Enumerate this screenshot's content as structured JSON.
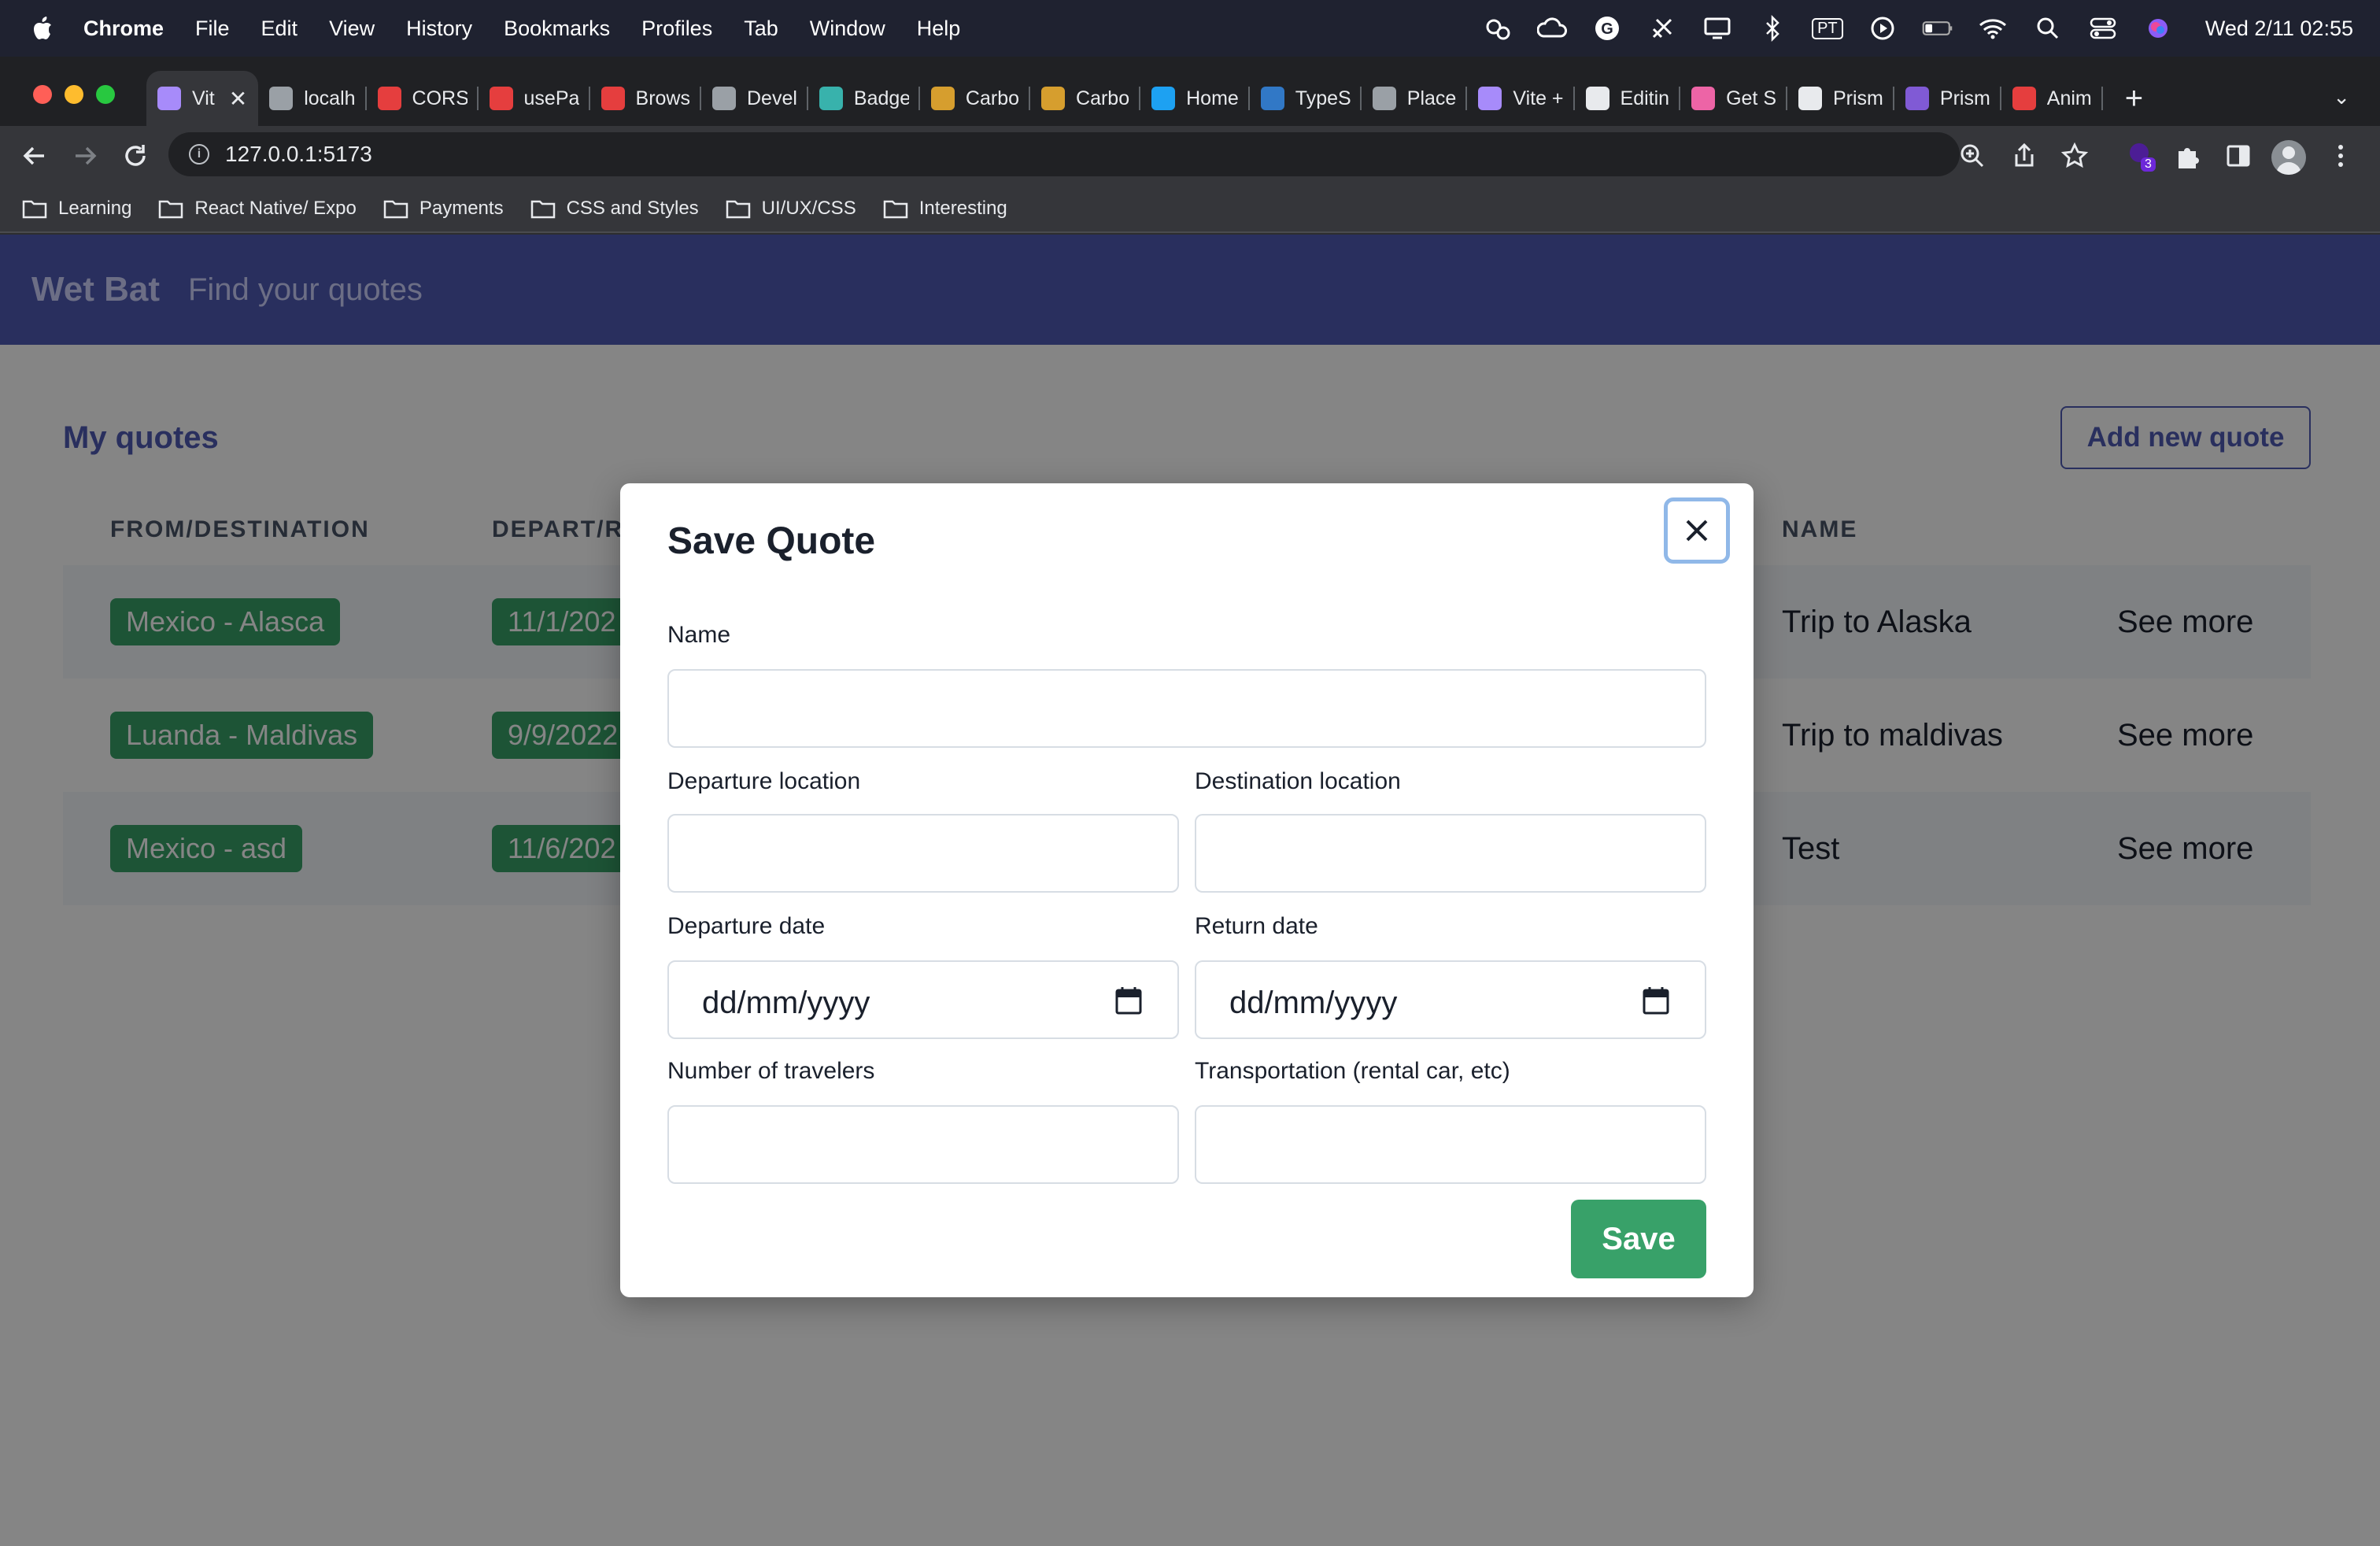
{
  "menubar": {
    "app": "Chrome",
    "items": [
      "File",
      "Edit",
      "View",
      "History",
      "Bookmarks",
      "Profiles",
      "Tab",
      "Window",
      "Help"
    ],
    "input_source": "PT",
    "clock": "Wed 2/11  02:55"
  },
  "browser": {
    "tabs": [
      {
        "label": "Vit",
        "active": true,
        "favicon_color": "#a78bfa"
      },
      {
        "label": "localh",
        "favicon_color": "#9aa0a6"
      },
      {
        "label": "CORS",
        "favicon_color": "#e53e3e"
      },
      {
        "label": "usePa",
        "favicon_color": "#e53e3e"
      },
      {
        "label": "Brows",
        "favicon_color": "#e53e3e"
      },
      {
        "label": "Devel",
        "favicon_color": "#9aa0a6"
      },
      {
        "label": "Badge",
        "favicon_color": "#38b2ac"
      },
      {
        "label": "Carbo",
        "favicon_color": "#d69e2e"
      },
      {
        "label": "Carbo",
        "favicon_color": "#d69e2e"
      },
      {
        "label": "Home",
        "favicon_color": "#1da1f2"
      },
      {
        "label": "TypeS",
        "favicon_color": "#3178c6"
      },
      {
        "label": "Place",
        "favicon_color": "#9aa0a6"
      },
      {
        "label": "Vite +",
        "favicon_color": "#a78bfa"
      },
      {
        "label": "Editin",
        "favicon_color": "#e8eaed"
      },
      {
        "label": "Get S",
        "favicon_color": "#ed64a6"
      },
      {
        "label": "Prism",
        "favicon_color": "#e8eaed"
      },
      {
        "label": "Prism",
        "favicon_color": "#805ad5"
      },
      {
        "label": "Anim",
        "favicon_color": "#e53e3e"
      }
    ],
    "url": "127.0.0.1:5173",
    "extension_badge": "3",
    "bookmarks": [
      "Learning",
      "React Native/ Expo",
      "Payments",
      "CSS and Styles",
      "UI/UX/CSS",
      "Interesting"
    ]
  },
  "app": {
    "brand": "Wet Bat",
    "tagline": "Find your quotes",
    "section_title": "My quotes",
    "add_button": "Add new quote",
    "columns": [
      "FROM/DESTINATION",
      "DEPART/R",
      "NAME"
    ],
    "rows": [
      {
        "route": "Mexico - Alasca",
        "date": "11/1/202",
        "name": "Trip to Alaska",
        "action": "See more"
      },
      {
        "route": "Luanda - Maldivas",
        "date": "9/9/2022",
        "name": "Trip to maldivas",
        "action": "See more"
      },
      {
        "route": "Mexico - asd",
        "date": "11/6/202",
        "name": "Test",
        "action": "See more"
      }
    ]
  },
  "modal": {
    "title": "Save Quote",
    "fields": {
      "name": {
        "label": "Name",
        "value": ""
      },
      "departure_location": {
        "label": "Departure location",
        "value": ""
      },
      "destination_location": {
        "label": "Destination location",
        "value": ""
      },
      "departure_date": {
        "label": "Departure date",
        "placeholder": "dd/mm/yyyy"
      },
      "return_date": {
        "label": "Return date",
        "placeholder": "dd/mm/yyyy"
      },
      "travelers": {
        "label": "Number of travelers",
        "value": ""
      },
      "transportation": {
        "label": "Transportation (rental car, etc)",
        "value": ""
      }
    },
    "save_label": "Save"
  },
  "colors": {
    "header": "#4f5bb5",
    "pill": "#38a169",
    "save": "#38a169",
    "focus_ring": "#90b8e8"
  }
}
